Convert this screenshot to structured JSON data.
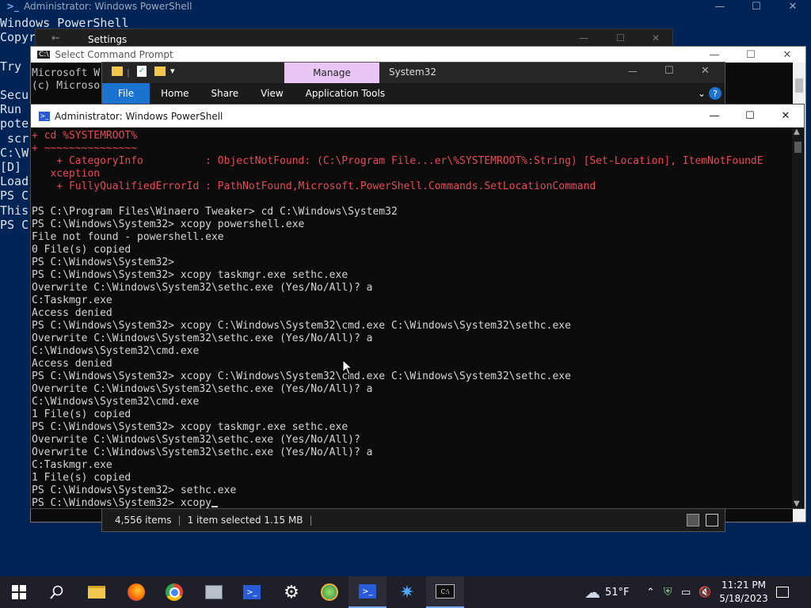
{
  "bg_ps": {
    "title": "Administrator: Windows PowerShell",
    "lines": [
      "Windows PowerShell",
      "Copyr",
      "",
      "Try ",
      "",
      "Secu",
      "Run ",
      "pote",
      " scr",
      "C:\\W",
      "[D] ",
      "Load",
      "PS C",
      "This",
      "PS C"
    ]
  },
  "settings": {
    "title": "Settings"
  },
  "cmd": {
    "title": "Select Command Prompt",
    "lines": [
      "Microsoft W",
      "(c) Microso"
    ]
  },
  "explorer": {
    "tabs": {
      "manage": "Manage",
      "location": "System32"
    },
    "ribbon": [
      "File",
      "Home",
      "Share",
      "View",
      "Application Tools"
    ],
    "status": {
      "items": "4,556 items",
      "selected": "1 item selected  1.15 MB"
    }
  },
  "main_ps": {
    "title": "Administrator: Windows PowerShell",
    "error_lines": [
      "+ cd %SYSTEMROOT%",
      "+ ~~~~~~~~~~~~~~~",
      "    + CategoryInfo          : ObjectNotFound: (C:\\Program File...er\\%SYSTEMROOT%:String) [Set-Location], ItemNotFoundE",
      "   xception",
      "    + FullyQualifiedErrorId : PathNotFound,Microsoft.PowerShell.Commands.SetLocationCommand"
    ],
    "lines": [
      "",
      "PS C:\\Program Files\\Winaero Tweaker> cd C:\\Windows\\System32",
      "PS C:\\Windows\\System32> xcopy powershell.exe",
      "File not found - powershell.exe",
      "0 File(s) copied",
      "PS C:\\Windows\\System32>",
      "PS C:\\Windows\\System32> xcopy taskmgr.exe sethc.exe",
      "Overwrite C:\\Windows\\System32\\sethc.exe (Yes/No/All)? a",
      "C:Taskmgr.exe",
      "Access denied",
      "PS C:\\Windows\\System32> xcopy C:\\Windows\\System32\\cmd.exe C:\\Windows\\System32\\sethc.exe",
      "Overwrite C:\\Windows\\System32\\sethc.exe (Yes/No/All)? a",
      "C:\\Windows\\System32\\cmd.exe",
      "Access denied",
      "PS C:\\Windows\\System32> xcopy C:\\Windows\\System32\\cmd.exe C:\\Windows\\System32\\sethc.exe",
      "Overwrite C:\\Windows\\System32\\sethc.exe (Yes/No/All)? a",
      "C:\\Windows\\System32\\cmd.exe",
      "1 File(s) copied",
      "PS C:\\Windows\\System32> xcopy taskmgr.exe sethc.exe",
      "Overwrite C:\\Windows\\System32\\sethc.exe (Yes/No/All)?",
      "Overwrite C:\\Windows\\System32\\sethc.exe (Yes/No/All)? a",
      "C:Taskmgr.exe",
      "1 File(s) copied",
      "PS C:\\Windows\\System32> sethc.exe"
    ],
    "prompt": "PS C:\\Windows\\System32> xcopy"
  },
  "taskbar": {
    "weather": "51°F",
    "time": "11:21 PM",
    "date": "5/18/2023"
  },
  "colors": {
    "error": "#e74856",
    "ps_bg": "#012456",
    "accent": "#1a73d1"
  }
}
